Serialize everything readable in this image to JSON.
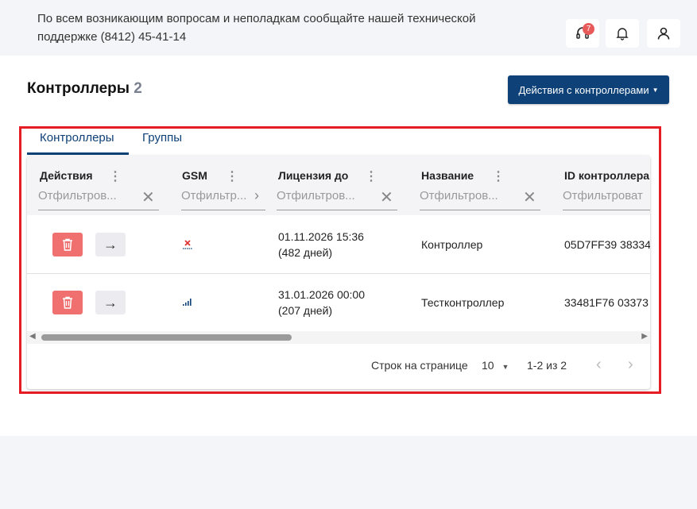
{
  "header": {
    "support_text": "По всем возникающим вопросам и неполадкам сообщайте нашей технической поддержке (8412) 45-41-14",
    "support_badge": "7"
  },
  "page": {
    "title": "Контроллеры",
    "count": "2",
    "actions_button": "Действия с контроллерами"
  },
  "tabs": [
    {
      "label": "Контроллеры",
      "active": true
    },
    {
      "label": "Группы",
      "active": false
    }
  ],
  "table": {
    "columns": [
      {
        "label": "Действия",
        "filter_placeholder": "Отфильтров..."
      },
      {
        "label": "GSM",
        "filter_placeholder": "Отфильтр..."
      },
      {
        "label": "Лицензия до",
        "filter_placeholder": "Отфильтров..."
      },
      {
        "label": "Название",
        "filter_placeholder": "Отфильтров..."
      },
      {
        "label": "ID контроллера",
        "filter_placeholder": "Отфильтроват"
      }
    ],
    "rows": [
      {
        "gsm": "no-signal-icon",
        "license_date": "01.11.2026 15:36",
        "license_days": "(482 дней)",
        "name": "Контроллер",
        "id": "05D7FF39 38334"
      },
      {
        "gsm": "signal-bars-icon",
        "license_date": "31.01.2026 00:00",
        "license_days": "(207 дней)",
        "name": "Тестконтроллер",
        "id": "33481F76 03373"
      }
    ]
  },
  "pagination": {
    "rows_per_page_label": "Строк на странице",
    "rows_per_page_value": "10",
    "range": "1-2 из 2"
  },
  "colors": {
    "primary": "#0d4177",
    "danger": "#f07070",
    "highlight": "#e51c23"
  }
}
